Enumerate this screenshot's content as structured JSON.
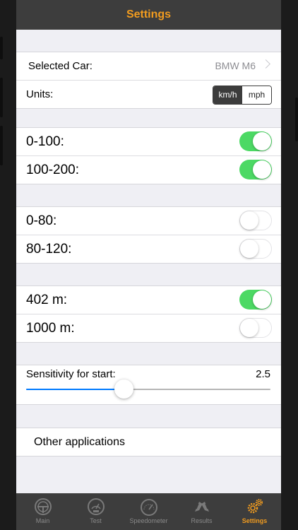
{
  "navbar": {
    "title": "Settings"
  },
  "car_group": {
    "selected_car_label": "Selected Car:",
    "selected_car_value": "BMW M6",
    "units_label": "Units:",
    "units_options": [
      "km/h",
      "mph"
    ],
    "units_selected": "km/h"
  },
  "groups": [
    {
      "rows": [
        {
          "label": "0-100:",
          "on": true
        },
        {
          "label": "100-200:",
          "on": true
        }
      ]
    },
    {
      "rows": [
        {
          "label": "0-80:",
          "on": false
        },
        {
          "label": "80-120:",
          "on": false
        }
      ]
    },
    {
      "rows": [
        {
          "label": "402 m:",
          "on": true
        },
        {
          "label": "1000 m:",
          "on": false
        }
      ]
    }
  ],
  "sensitivity": {
    "label": "Sensitivity for start:",
    "value": "2.5",
    "level": 0.4
  },
  "other": {
    "label": "Other applications"
  },
  "tabbar": {
    "tabs": [
      {
        "label": "Main",
        "icon": "steering-wheel-icon"
      },
      {
        "label": "Test",
        "icon": "gauge-icon"
      },
      {
        "label": "Speedometer",
        "icon": "speedometer-icon"
      },
      {
        "label": "Results",
        "icon": "racing-flags-icon"
      },
      {
        "label": "Settings",
        "icon": "gears-icon",
        "active": true
      }
    ]
  },
  "colors": {
    "accent": "#f29c1f",
    "toggle_on": "#4cd964",
    "slider_fill": "#007aff",
    "bar_bg": "#3d3d3d"
  }
}
